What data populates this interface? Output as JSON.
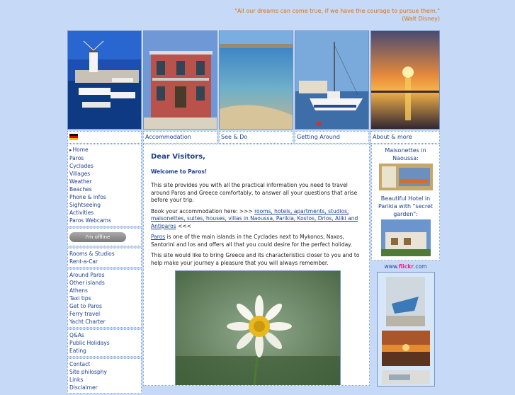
{
  "quote": {
    "text": "\"All our dreams can come true, if we have the courage to pursue them.\"",
    "author": "(Walt Disney)"
  },
  "photos": [
    {
      "name": "windmill-harbor-photo"
    },
    {
      "name": "red-house-photo"
    },
    {
      "name": "beach-water-photo"
    },
    {
      "name": "fishing-boat-photo"
    },
    {
      "name": "sunset-photo"
    }
  ],
  "topnav": [
    "",
    "Accommodation",
    "See & Do",
    "Getting Around",
    "About & more"
  ],
  "leftnav": {
    "group1": [
      "Home",
      "Paros",
      "Cyclades",
      "Villages",
      "Weather",
      "Beaches",
      "Phone & infos",
      "Sightseeing",
      "Activities",
      "Paros Webcams"
    ],
    "offline": "I'm offline",
    "group2": [
      "Rooms & Studios",
      "Rent-a-Car"
    ],
    "group3": [
      "Around Paros",
      "Other islands",
      "Athens",
      "Taxi tips",
      "Get to Paros",
      "Ferry travel",
      "Yacht Charter"
    ],
    "group4": [
      "Q&As",
      "Public Holidays",
      "Eating"
    ],
    "group5": [
      "Contact",
      "Site philosphy",
      "Links",
      "Disclaimer"
    ]
  },
  "main": {
    "title": "Dear Visitors,",
    "welcome": "Welcome to Paros!",
    "p1": "This site provides you with all the practical information you need to travel around Paros and Greece comfortably, to answer all your questions that arise before your trip.",
    "p2_prefix": "Book your accommodation here: >>> ",
    "p2_link": "rooms, hotels, apartments, studios, maisonettes, suites, houses, villas in Naoussa, Parikia, Kostos, Drios, Aliki and Antiparos",
    "p2_suffix": " <<<",
    "p3_link": "Paros",
    "p3_text": " is one of the main islands in the Cyclades next to Mykonos, Naxos, Santorini and Ios and offers all that you could desire for the perfect holiday.",
    "p4": "This site would like to bring Greece and its characteristics closer to you and to help make your journey a pleasure that you will always remember."
  },
  "right": {
    "box1": "Maisonettes in Naoussa:",
    "box2": "Beautiful Hotel in Parikia with \"secret garden\":",
    "flickr_prefix": "www.",
    "flickr_brand": "flickr",
    "flickr_suffix": ".com"
  }
}
